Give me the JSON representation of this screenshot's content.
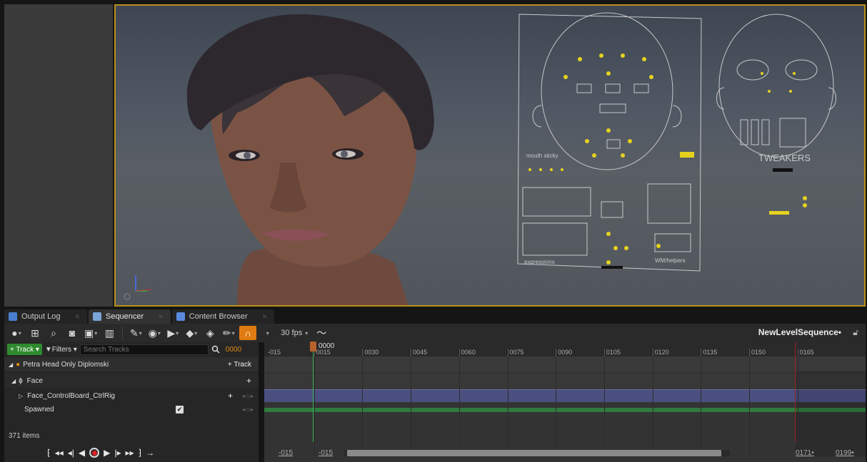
{
  "tabs": [
    {
      "label": "Output Log",
      "color": "#4a7fd0"
    },
    {
      "label": "Sequencer",
      "color": "#7aa5d8"
    },
    {
      "label": "Content Browser",
      "color": "#5a8ae0"
    }
  ],
  "toolbar": {
    "fps": "30 fps",
    "sequence_name": "NewLevelSequence•",
    "icons": [
      "world-icon",
      "save-icon",
      "find-icon",
      "camera-icon",
      "render-icon",
      "actor-icon",
      "tools-icon",
      "view-icon",
      "play-icon",
      "key-icon",
      "keyframe-icon",
      "brush-icon",
      "snap-magnet-icon",
      "curve-editor-icon"
    ]
  },
  "outliner": {
    "add_track_label": "+ Track ▾",
    "filters_label": "▼Filters ▾",
    "search_placeholder": "Search Tracks",
    "current_frame": "0000",
    "rows": {
      "petra": {
        "label": "Petra Head Only Diplomski",
        "action": "+ Track"
      },
      "face": {
        "label": "Face"
      },
      "ctrl": {
        "label": "Face_ControlBoard_CtrlRig"
      },
      "spawned": {
        "label": "Spawned",
        "checked": true
      }
    },
    "items_count": "371 items"
  },
  "timeline": {
    "playhead_label": "0000",
    "ticks": [
      "-015",
      "0015",
      "0030",
      "0045",
      "0060",
      "0075",
      "0090",
      "0105",
      "0120",
      "0135",
      "0150",
      "0165"
    ],
    "view_start": "-015",
    "work_start": "-015",
    "work_end": "0171•",
    "view_end": "0199•"
  },
  "viewport": {
    "control_board_label_1": "mouth sticky",
    "control_board_label_2": "expressions",
    "control_board_label_3": "TWEAKERS",
    "control_board_label_4": "WM/helpers"
  },
  "colors": {
    "accent": "#e07b12",
    "viewport_border": "#b8901a",
    "playhead": "#39b04f",
    "end_marker": "#9a2222",
    "track_bar": "#4a4f80"
  }
}
